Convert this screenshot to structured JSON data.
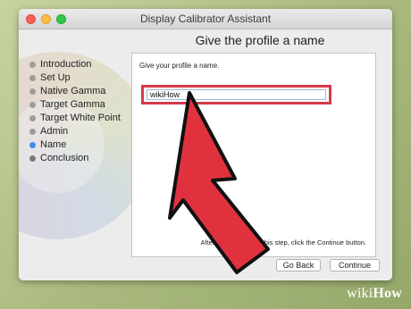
{
  "window": {
    "title": "Display Calibrator Assistant"
  },
  "page": {
    "title": "Give the profile a name"
  },
  "sidebar": {
    "steps": [
      {
        "label": "Introduction",
        "state": "done"
      },
      {
        "label": "Set Up",
        "state": "done"
      },
      {
        "label": "Native Gamma",
        "state": "done"
      },
      {
        "label": "Target Gamma",
        "state": "done"
      },
      {
        "label": "Target White Point",
        "state": "done"
      },
      {
        "label": "Admin",
        "state": "done"
      },
      {
        "label": "Name",
        "state": "current"
      },
      {
        "label": "Conclusion",
        "state": "future"
      }
    ]
  },
  "content": {
    "prompt": "Give your profile a name.",
    "name_value": "wikiHow",
    "hint": "After you have done this step, click the Continue button."
  },
  "buttons": {
    "back_label": "Go Back",
    "continue_label": "Continue"
  },
  "watermark": {
    "brand": "wiki",
    "suffix": "How"
  },
  "colors": {
    "highlight": "#d63a4a",
    "arrow_fill": "#e0323e",
    "step_current": "#3b8fe6",
    "step_done": "#9c9c9c"
  },
  "icons": {
    "arrow": "red-pointer-arrow"
  }
}
